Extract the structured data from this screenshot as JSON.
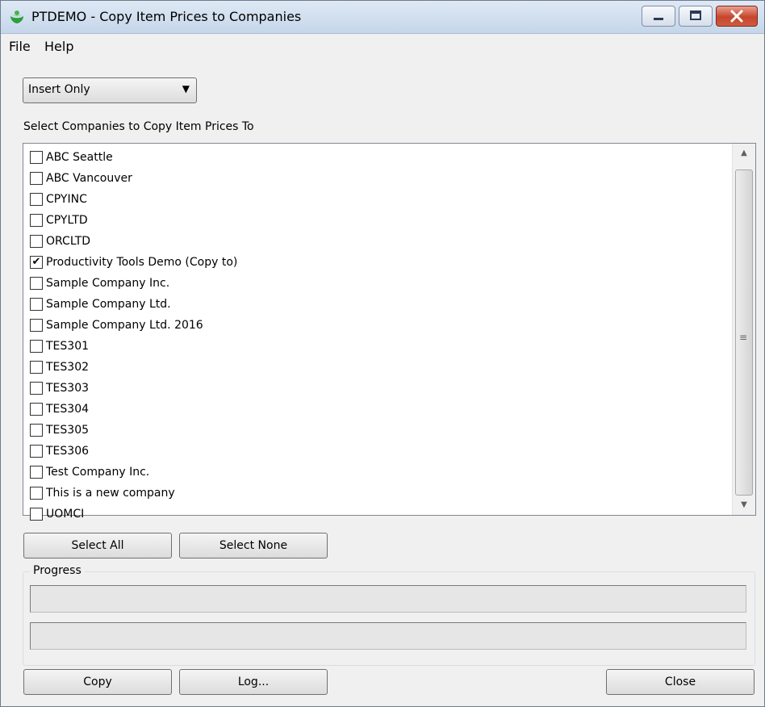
{
  "window": {
    "title": "PTDEMO - Copy Item Prices to Companies",
    "icon": "app-logo-icon"
  },
  "menu": {
    "file": "File",
    "help": "Help"
  },
  "mode_select": {
    "value": "Insert Only"
  },
  "section_label": "Select Companies to Copy Item Prices To",
  "companies": [
    {
      "label": "ABC Seattle",
      "checked": false
    },
    {
      "label": "ABC Vancouver",
      "checked": false
    },
    {
      "label": "CPYINC",
      "checked": false
    },
    {
      "label": "CPYLTD",
      "checked": false
    },
    {
      "label": "ORCLTD",
      "checked": false
    },
    {
      "label": "Productivity Tools Demo (Copy to)",
      "checked": true
    },
    {
      "label": "Sample Company Inc.",
      "checked": false
    },
    {
      "label": "Sample Company Ltd.",
      "checked": false
    },
    {
      "label": "Sample Company Ltd. 2016",
      "checked": false
    },
    {
      "label": "TES301",
      "checked": false
    },
    {
      "label": "TES302",
      "checked": false
    },
    {
      "label": "TES303",
      "checked": false
    },
    {
      "label": "TES304",
      "checked": false
    },
    {
      "label": "TES305",
      "checked": false
    },
    {
      "label": "TES306",
      "checked": false
    },
    {
      "label": "Test Company Inc.",
      "checked": false
    },
    {
      "label": "This is a new company",
      "checked": false
    },
    {
      "label": "UOMCI",
      "checked": false
    }
  ],
  "buttons": {
    "select_all": "Select All",
    "select_none": "Select None",
    "copy": "Copy",
    "log": "Log...",
    "close": "Close"
  },
  "progress": {
    "label": "Progress",
    "bar1": 0,
    "bar2": 0
  },
  "colors": {
    "titlebar": "#c5d6ea",
    "close_button": "#c6452c"
  }
}
